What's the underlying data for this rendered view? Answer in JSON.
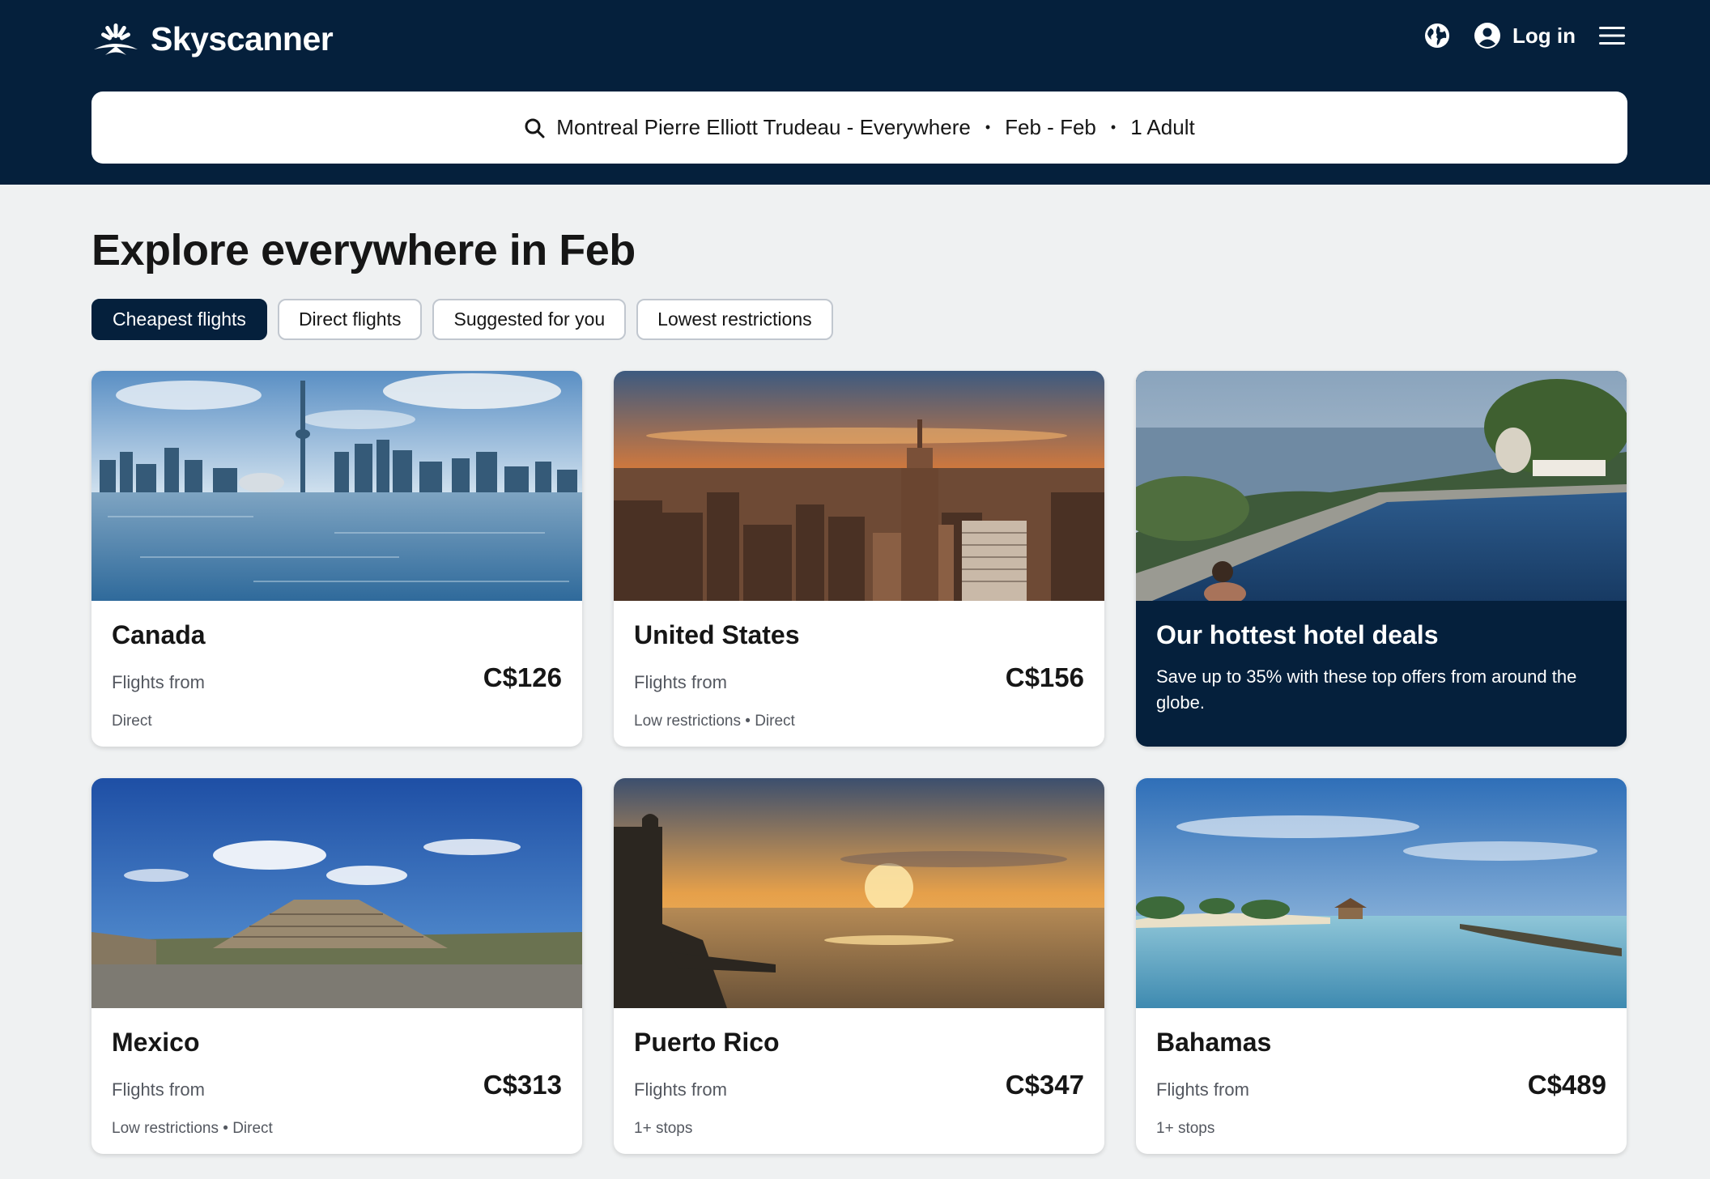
{
  "header": {
    "brand": "Skyscanner",
    "login_label": "Log in",
    "icons": {
      "region": "globe-icon",
      "account": "user-circle-icon",
      "menu": "hamburger-menu-icon"
    }
  },
  "search": {
    "route": "Montreal Pierre Elliott Trudeau - Everywhere",
    "separator": "•",
    "dates": "Feb - Feb",
    "travellers": "1 Adult"
  },
  "main": {
    "title": "Explore everywhere in Feb",
    "filters": [
      {
        "label": "Cheapest flights",
        "active": true
      },
      {
        "label": "Direct flights",
        "active": false
      },
      {
        "label": "Suggested for you",
        "active": false
      },
      {
        "label": "Lowest restrictions",
        "active": false
      }
    ]
  },
  "destinations": [
    {
      "name": "Canada",
      "from_label": "Flights from",
      "price": "C$126",
      "tags": "Direct"
    },
    {
      "name": "United States",
      "from_label": "Flights from",
      "price": "C$156",
      "tags": "Low restrictions • Direct"
    },
    {
      "name": "Mexico",
      "from_label": "Flights from",
      "price": "C$313",
      "tags": "Low restrictions • Direct"
    },
    {
      "name": "Puerto Rico",
      "from_label": "Flights from",
      "price": "C$347",
      "tags": "1+ stops"
    },
    {
      "name": "Bahamas",
      "from_label": "Flights from",
      "price": "C$489",
      "tags": "1+ stops"
    }
  ],
  "promo": {
    "title": "Our hottest hotel deals",
    "description": "Save up to 35% with these top offers from around the globe."
  },
  "colors": {
    "navy": "#05203c",
    "page_bg": "#eff1f2",
    "text": "#161616",
    "muted": "#545860"
  }
}
